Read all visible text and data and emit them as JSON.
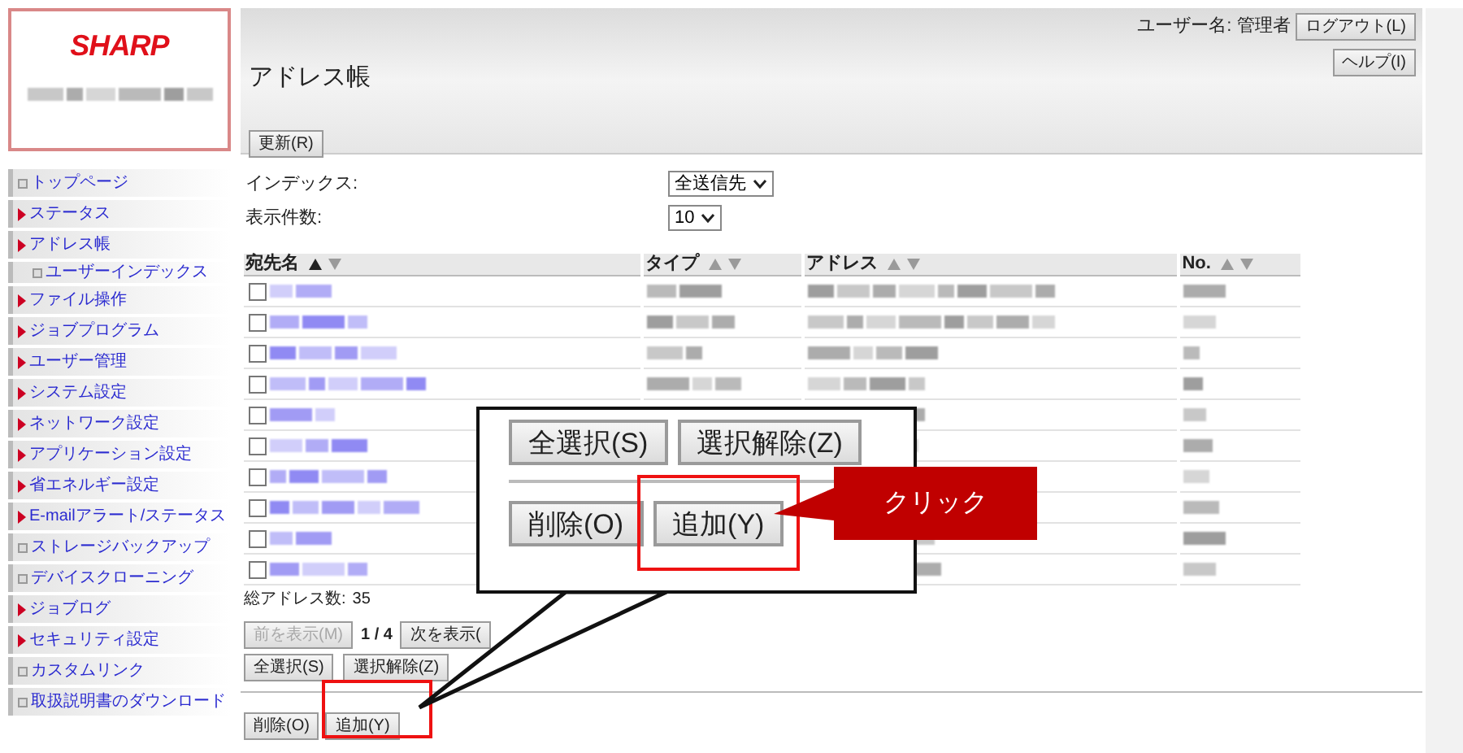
{
  "logo": {
    "brand": "SHARP"
  },
  "sidebar": {
    "items": [
      {
        "label": "トップページ",
        "kind": "page"
      },
      {
        "label": "ステータス",
        "kind": "folder"
      },
      {
        "label": "アドレス帳",
        "kind": "folder",
        "children": [
          {
            "label": "ユーザーインデックス",
            "kind": "page"
          }
        ]
      },
      {
        "label": "ファイル操作",
        "kind": "folder"
      },
      {
        "label": "ジョブプログラム",
        "kind": "folder"
      },
      {
        "label": "ユーザー管理",
        "kind": "folder"
      },
      {
        "label": "システム設定",
        "kind": "folder"
      },
      {
        "label": "ネットワーク設定",
        "kind": "folder"
      },
      {
        "label": "アプリケーション設定",
        "kind": "folder"
      },
      {
        "label": "省エネルギー設定",
        "kind": "folder"
      },
      {
        "label": "E-mailアラート/ステータス",
        "kind": "folder"
      },
      {
        "label": "ストレージバックアップ",
        "kind": "page"
      },
      {
        "label": "デバイスクローニング",
        "kind": "page"
      },
      {
        "label": "ジョブログ",
        "kind": "folder"
      },
      {
        "label": "セキュリティ設定",
        "kind": "folder"
      },
      {
        "label": "カスタムリンク",
        "kind": "page"
      },
      {
        "label": "取扱説明書のダウンロード",
        "kind": "page"
      }
    ]
  },
  "header": {
    "title": "アドレス帳",
    "user_label": "ユーザー名: 管理者",
    "logout": "ログアウト(L)",
    "help": "ヘルプ(I)",
    "refresh": "更新(R)"
  },
  "filters": [
    {
      "label": "インデックス:",
      "value": "全送信先"
    },
    {
      "label": "表示件数:",
      "value": "10"
    }
  ],
  "table": {
    "columns": [
      {
        "label": "宛先名",
        "sort_asc": true
      },
      {
        "label": "タイプ",
        "sort_asc": false
      },
      {
        "label": "アドレス",
        "sort_asc": false
      },
      {
        "label": "No.",
        "sort_asc": false
      }
    ],
    "rows": [
      {
        "checked": false
      },
      {
        "checked": false
      },
      {
        "checked": false
      },
      {
        "checked": false
      },
      {
        "checked": false
      },
      {
        "checked": false
      },
      {
        "checked": false
      },
      {
        "checked": false
      },
      {
        "checked": false
      },
      {
        "checked": false
      }
    ]
  },
  "total": {
    "label": "総アドレス数:",
    "value": "35"
  },
  "pager": {
    "prev": {
      "label": "前を表示(M)",
      "disabled": true
    },
    "page": "1 / 4",
    "next": {
      "label": "次を表示(",
      "disabled": false
    }
  },
  "select_buttons": [
    "全選択(S)",
    "選択解除(Z)"
  ],
  "action_buttons": [
    "削除(O)",
    "追加(Y)"
  ],
  "callout": {
    "select_buttons": [
      "全選択(S)",
      "選択解除(Z)"
    ],
    "action_buttons": [
      "削除(O)",
      "追加(Y)"
    ],
    "label": "クリック"
  }
}
